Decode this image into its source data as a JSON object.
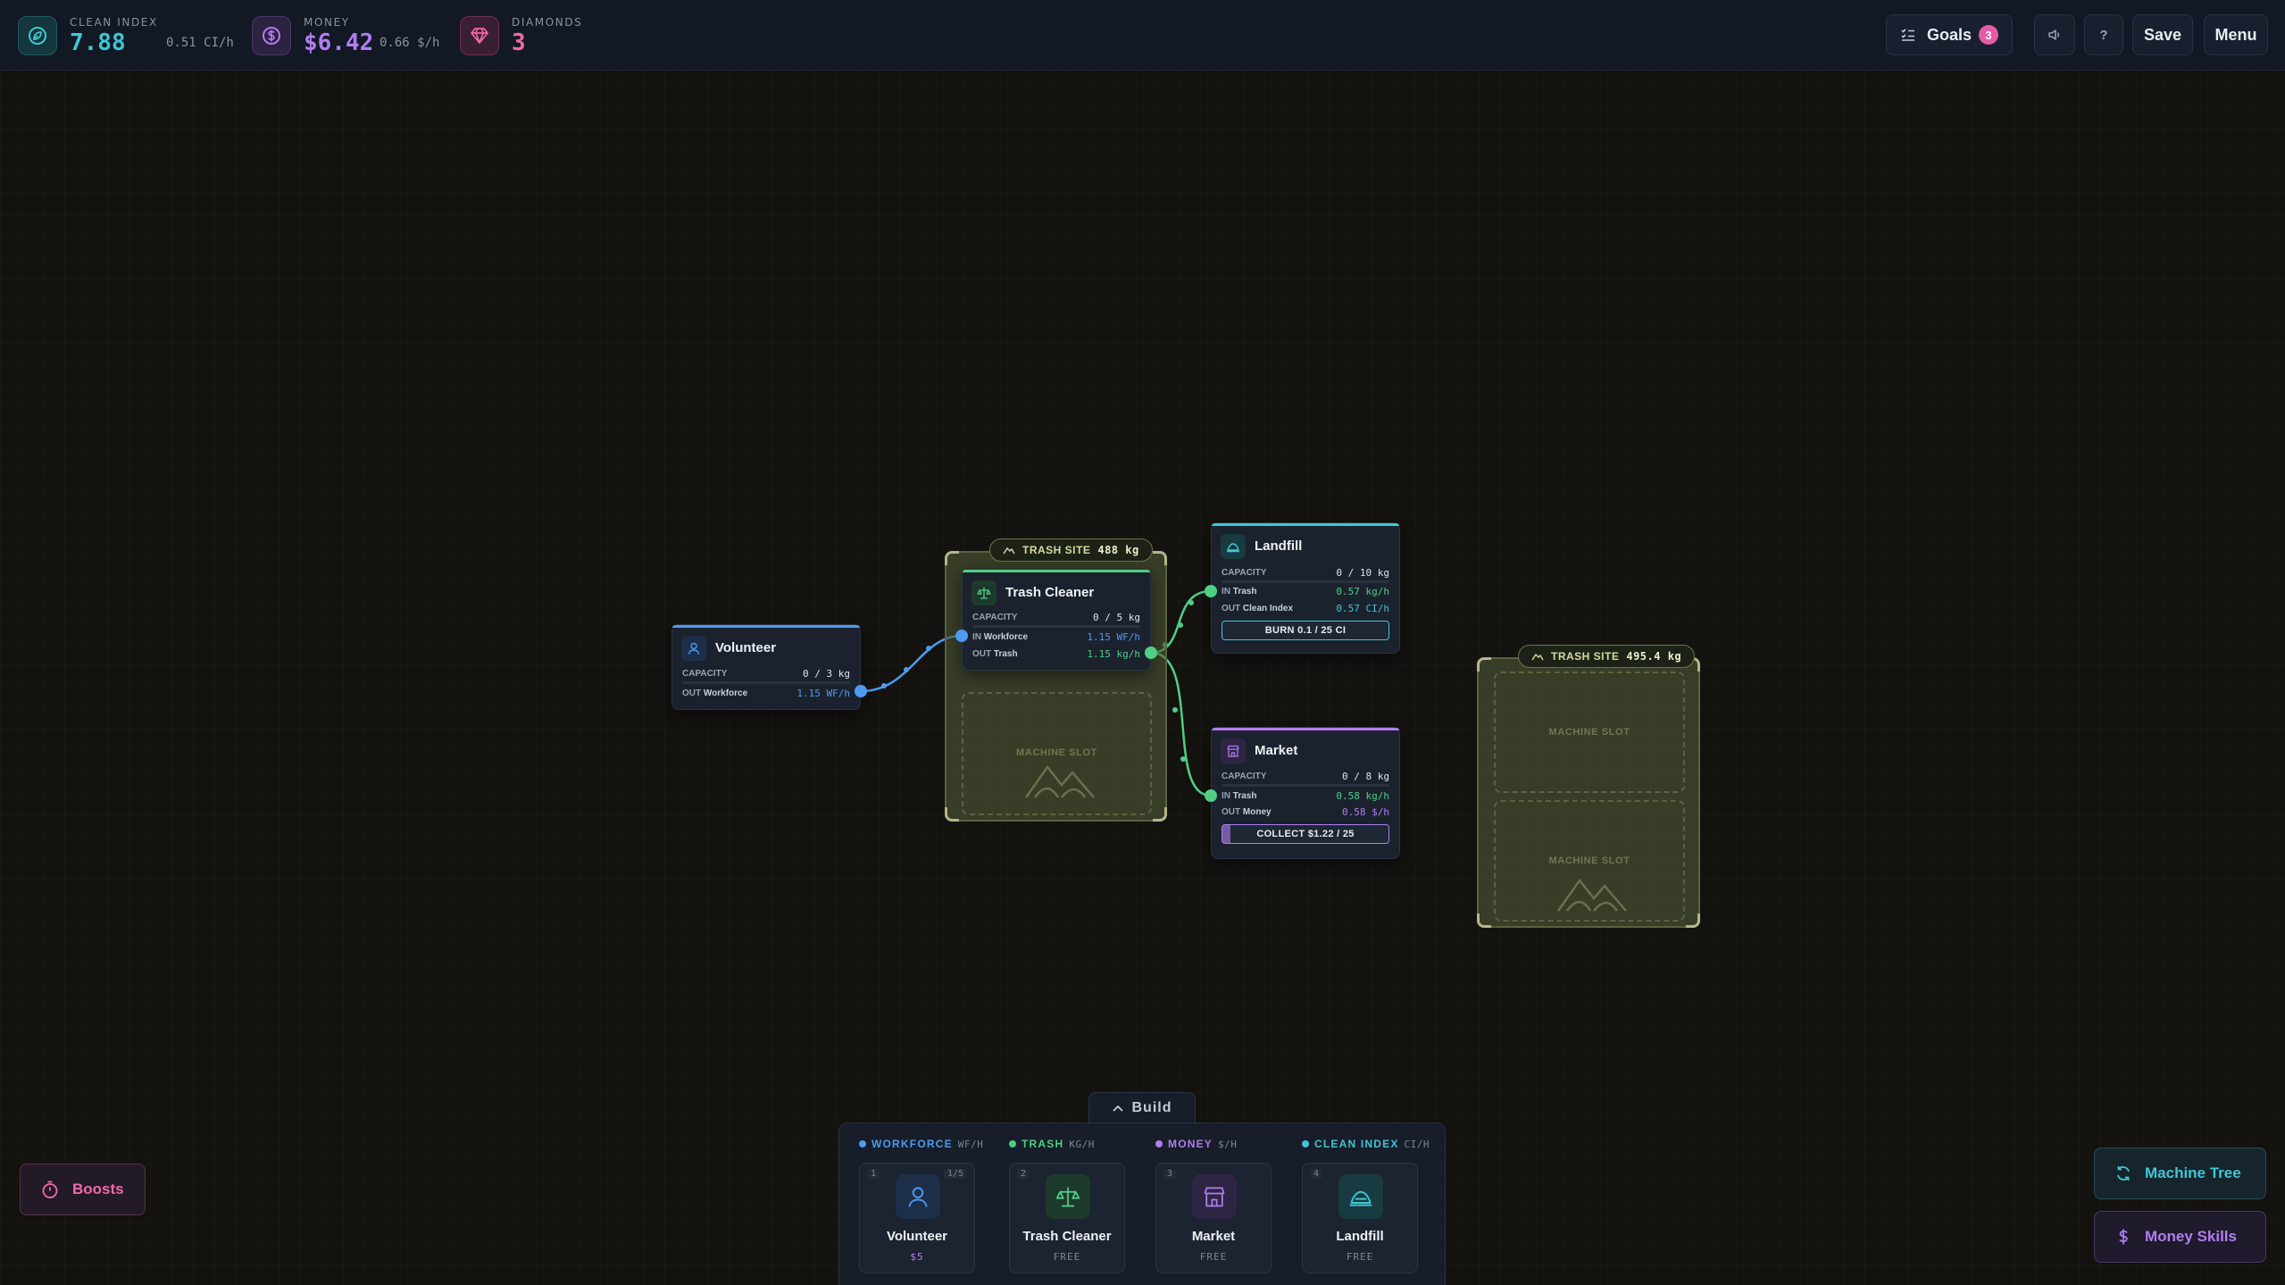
{
  "stats": {
    "clean_index": {
      "label": "CLEAN INDEX",
      "value": "7.88",
      "rate": "0.51 CI/h",
      "icon": "leaf-icon"
    },
    "money": {
      "label": "MONEY",
      "value": "$6.42",
      "rate": "0.66 $/h",
      "icon": "dollar-icon"
    },
    "diamonds": {
      "label": "DIAMONDS",
      "value": "3",
      "icon": "diamond-icon"
    }
  },
  "toolbar": {
    "goals_label": "Goals",
    "goals_count": "3",
    "help_label": "?",
    "save_label": "Save",
    "menu_label": "Menu"
  },
  "sites": [
    {
      "label": "TRASH SITE",
      "amount": "488 kg",
      "slots": [
        "MACHINE SLOT"
      ]
    },
    {
      "label": "TRASH SITE",
      "amount": "495.4 kg",
      "slots": [
        "MACHINE SLOT",
        "MACHINE SLOT"
      ]
    }
  ],
  "machines": {
    "volunteer": {
      "title": "Volunteer",
      "capacity_label": "CAPACITY",
      "capacity": "0 / 3 kg",
      "out_label": "OUT",
      "out_name": "Workforce",
      "out_value": "1.15 WF/h"
    },
    "trash_cleaner": {
      "title": "Trash Cleaner",
      "capacity_label": "CAPACITY",
      "capacity": "0 / 5 kg",
      "in_label": "IN",
      "in_name": "Workforce",
      "in_value": "1.15 WF/h",
      "out_label": "OUT",
      "out_name": "Trash",
      "out_value": "1.15 kg/h"
    },
    "landfill": {
      "title": "Landfill",
      "capacity_label": "CAPACITY",
      "capacity": "0 / 10 kg",
      "in_label": "IN",
      "in_name": "Trash",
      "in_value": "0.57 kg/h",
      "out_label": "OUT",
      "out_name": "Clean Index",
      "out_value": "0.57 CI/h",
      "button": "BURN 0.1 / 25 CI"
    },
    "market": {
      "title": "Market",
      "capacity_label": "CAPACITY",
      "capacity": "0 / 8 kg",
      "in_label": "IN",
      "in_name": "Trash",
      "in_value": "0.58 kg/h",
      "out_label": "OUT",
      "out_name": "Money",
      "out_value": "0.58 $/h",
      "button": "COLLECT $1.22 / 25",
      "collect_progress": 0.05
    }
  },
  "build": {
    "tab_label": "Build",
    "categories": [
      {
        "name": "WORKFORCE",
        "unit": "WF/H",
        "color": "#4d9bf0"
      },
      {
        "name": "TRASH",
        "unit": "KG/H",
        "color": "#4fcf86"
      },
      {
        "name": "MONEY",
        "unit": "$/H",
        "color": "#b07ef0"
      },
      {
        "name": "CLEAN INDEX",
        "unit": "CI/H",
        "color": "#3fc6d3"
      }
    ],
    "items": [
      {
        "num": "1",
        "limit": "1/5",
        "name": "Volunteer",
        "cost": "$5"
      },
      {
        "num": "2",
        "name": "Trash Cleaner",
        "cost": "FREE"
      },
      {
        "num": "3",
        "name": "Market",
        "cost": "FREE"
      },
      {
        "num": "4",
        "name": "Landfill",
        "cost": "FREE"
      }
    ]
  },
  "corner": {
    "boosts": "Boosts",
    "machine_tree": "Machine Tree",
    "money_skills": "Money Skills"
  },
  "colors": {
    "workforce": "#4d9bf0",
    "trash": "#4fcf86",
    "money": "#b07ef0",
    "clean_index": "#3fc6d3",
    "diamonds": "#f06aa9"
  }
}
